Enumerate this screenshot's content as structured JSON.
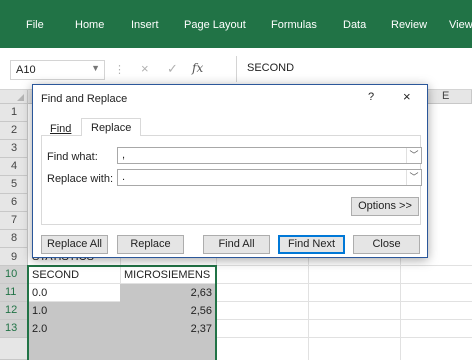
{
  "ribbon": {
    "tabs": [
      "File",
      "Home",
      "Insert",
      "Page Layout",
      "Formulas",
      "Data",
      "Review",
      "View"
    ]
  },
  "formula_bar": {
    "name_box": "A10",
    "fx": "fx",
    "cancel": "×",
    "enter": "✓",
    "value": "SECOND"
  },
  "sheet": {
    "visible_column_letter": "E",
    "row_numbers": [
      "1",
      "2",
      "3",
      "4",
      "5",
      "6",
      "7",
      "8",
      "9",
      "10",
      "11",
      "12",
      "13"
    ],
    "a9": "STATISTICS",
    "headers": [
      "SECOND",
      "MICROSIEMENS"
    ],
    "rows": [
      {
        "a": "0.0",
        "b": "2,63"
      },
      {
        "a": "1.0",
        "b": "2,56"
      },
      {
        "a": "2.0",
        "b": "2,37"
      }
    ]
  },
  "dialog": {
    "title": "Find and Replace",
    "help": "?",
    "close": "×",
    "tabs": [
      "Find",
      "Replace"
    ],
    "active_tab": "Replace",
    "find_label": "Find what:",
    "find_value": ",",
    "replace_label": "Replace with:",
    "replace_value": ".",
    "options_button": "Options >>",
    "buttons": [
      "Replace All",
      "Replace",
      "Find All",
      "Find Next",
      "Close"
    ],
    "accent": "#0078d7"
  },
  "colors": {
    "ribbon": "#217346",
    "selection_border": "#217346"
  }
}
